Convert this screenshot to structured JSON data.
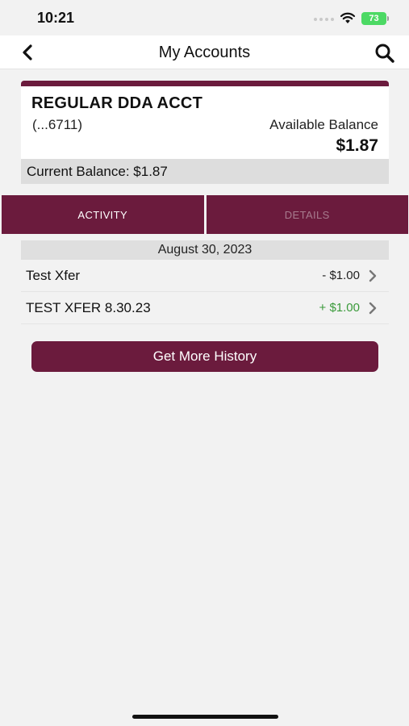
{
  "status_bar": {
    "time": "10:21",
    "battery": "73",
    "battery_color": "#4cd964",
    "icons": [
      "signal-dots-icon",
      "wifi-icon",
      "battery-icon"
    ]
  },
  "nav": {
    "back_icon": "chevron-left-icon",
    "title": "My Accounts",
    "search_icon": "search-icon"
  },
  "account": {
    "name": "REGULAR DDA ACCT",
    "number": "(...6711)",
    "available_label": "Available Balance",
    "available_amount": "$1.87",
    "current_balance": "Current Balance: $1.87"
  },
  "tabs": [
    {
      "label": "ACTIVITY",
      "active": true
    },
    {
      "label": "DETAILS",
      "active": false
    }
  ],
  "activity": {
    "date": "August 30, 2023",
    "transactions": [
      {
        "description": "Test Xfer",
        "amount": "- $1.00",
        "amount_color": "#222222"
      },
      {
        "description": "TEST XFER 8.30.23",
        "amount": "+ $1.00",
        "amount_color": "#3a9a3a"
      }
    ]
  },
  "buttons": {
    "more_history": "Get More History"
  },
  "theme": {
    "brand": "#6b1b3d",
    "background": "#f2f2f2"
  }
}
